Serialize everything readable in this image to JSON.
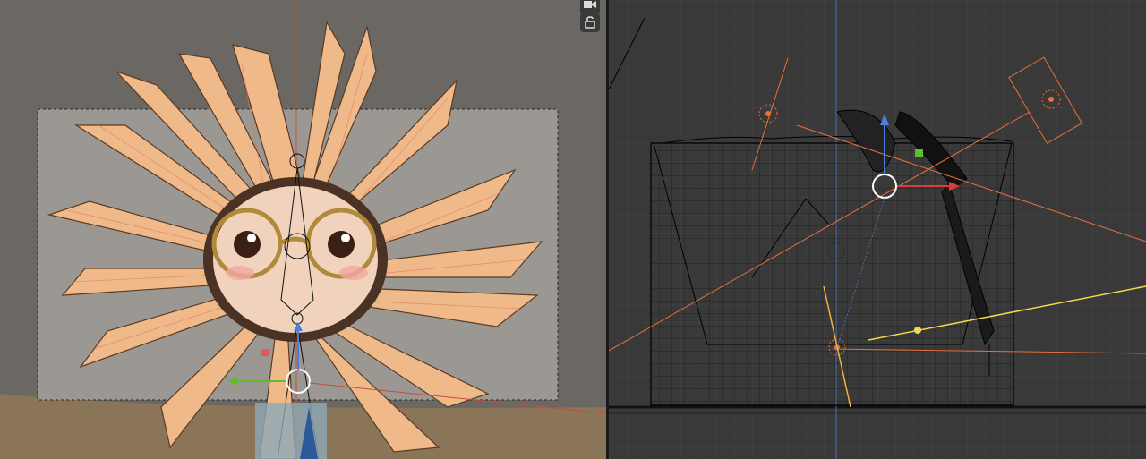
{
  "app": {
    "title": ""
  },
  "left_viewport": {
    "name": "camera-view",
    "header_buttons": [
      {
        "name": "camera-icon"
      },
      {
        "name": "lock-icon"
      }
    ],
    "colors": {
      "background": "#6b6863",
      "frame": "#9b9893",
      "petal": "#f0b98a",
      "face": "#f1d2bd"
    }
  },
  "right_viewport": {
    "name": "wireframe-view",
    "colors": {
      "background": "#393939",
      "wire": "#000000",
      "orange": "#e8703a",
      "blue_axis": "#4a7fe0",
      "red_axis": "#e03a3a",
      "yellow": "#f2d84a",
      "green": "#5cbf2a"
    }
  }
}
